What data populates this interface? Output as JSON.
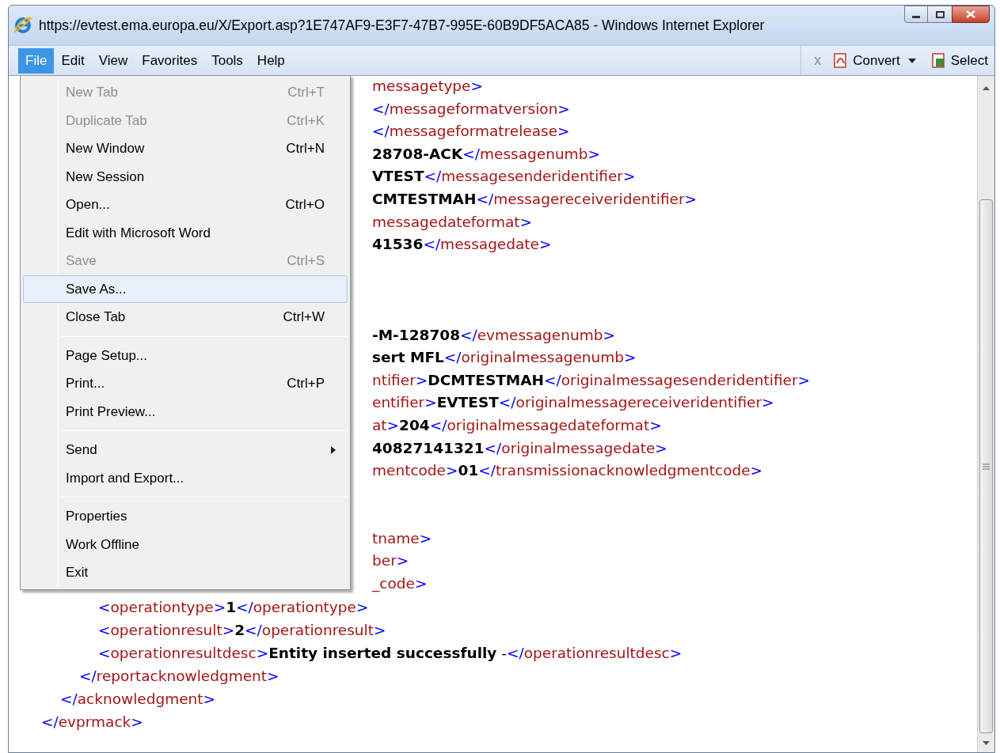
{
  "window": {
    "title": "https://evtest.ema.europa.eu/X/Export.asp?1E747AF9-E3F7-47B7-995E-60B9DF5ACA85 - Windows Internet Explorer"
  },
  "menu_bar": [
    {
      "label": "File",
      "selected": true
    },
    {
      "label": "Edit",
      "selected": false
    },
    {
      "label": "View",
      "selected": false
    },
    {
      "label": "Favorites",
      "selected": false
    },
    {
      "label": "Tools",
      "selected": false
    },
    {
      "label": "Help",
      "selected": false
    }
  ],
  "toolbar": {
    "close": "x",
    "convert": "Convert",
    "select": "Select"
  },
  "file_menu": {
    "groups": [
      [
        {
          "label": "New Tab",
          "shortcut": "Ctrl+T",
          "disabled": true,
          "selected": false
        },
        {
          "label": "Duplicate Tab",
          "shortcut": "Ctrl+K",
          "disabled": true,
          "selected": false
        },
        {
          "label": "New Window",
          "shortcut": "Ctrl+N",
          "disabled": false,
          "selected": false
        },
        {
          "label": "New Session",
          "disabled": false,
          "selected": false
        },
        {
          "label": "Open...",
          "shortcut": "Ctrl+O",
          "disabled": false,
          "selected": false
        },
        {
          "label": "Edit with Microsoft Word",
          "disabled": false,
          "selected": false
        },
        {
          "label": "Save",
          "shortcut": "Ctrl+S",
          "disabled": true,
          "selected": false
        },
        {
          "label": "Save As...",
          "disabled": false,
          "selected": true
        },
        {
          "label": "Close Tab",
          "shortcut": "Ctrl+W",
          "disabled": false,
          "selected": false
        }
      ],
      [
        {
          "label": "Page Setup...",
          "disabled": false,
          "selected": false
        },
        {
          "label": "Print...",
          "shortcut": "Ctrl+P",
          "disabled": false,
          "selected": false
        },
        {
          "label": "Print Preview...",
          "disabled": false,
          "selected": false
        }
      ],
      [
        {
          "label": "Send",
          "disabled": false,
          "selected": false,
          "submenu": true
        },
        {
          "label": "Import and Export...",
          "disabled": false,
          "selected": false
        }
      ],
      [
        {
          "label": "Properties",
          "disabled": false,
          "selected": false
        },
        {
          "label": "Work Offline",
          "disabled": false,
          "selected": false
        },
        {
          "label": "Exit",
          "disabled": false,
          "selected": false
        }
      ]
    ]
  },
  "document": {
    "lines": [
      {
        "kind": "partial",
        "parts": [
          {
            "kind": "tag",
            "text": "messagetype"
          },
          {
            "kind": "punct",
            "text": ">"
          }
        ]
      },
      {
        "kind": "partial",
        "parts": [
          {
            "kind": "punct",
            "text": "</"
          },
          {
            "kind": "tag",
            "text": "messageformatversion"
          },
          {
            "kind": "punct",
            "text": ">"
          }
        ]
      },
      {
        "kind": "partial",
        "parts": [
          {
            "kind": "punct",
            "text": "</"
          },
          {
            "kind": "tag",
            "text": "messageformatrelease"
          },
          {
            "kind": "punct",
            "text": ">"
          }
        ]
      },
      {
        "kind": "partial",
        "parts": [
          {
            "kind": "value",
            "text": "28708-ACK"
          },
          {
            "kind": "punct",
            "text": "</"
          },
          {
            "kind": "tag",
            "text": "messagenumb"
          },
          {
            "kind": "punct",
            "text": ">"
          }
        ]
      },
      {
        "kind": "partial",
        "parts": [
          {
            "kind": "value",
            "text": "VTEST"
          },
          {
            "kind": "punct",
            "text": "</"
          },
          {
            "kind": "tag",
            "text": "messagesenderidentifier"
          },
          {
            "kind": "punct",
            "text": ">"
          }
        ]
      },
      {
        "kind": "partial",
        "parts": [
          {
            "kind": "value",
            "text": "CMTESTMAH"
          },
          {
            "kind": "punct",
            "text": "</"
          },
          {
            "kind": "tag",
            "text": "messagereceiveridentifier"
          },
          {
            "kind": "punct",
            "text": ">"
          }
        ]
      },
      {
        "kind": "partial",
        "parts": [
          {
            "kind": "tag",
            "text": "messagedateformat"
          },
          {
            "kind": "punct",
            "text": ">"
          }
        ]
      },
      {
        "kind": "partial",
        "parts": [
          {
            "kind": "value",
            "text": "41536"
          },
          {
            "kind": "punct",
            "text": "</"
          },
          {
            "kind": "tag",
            "text": "messagedate"
          },
          {
            "kind": "punct",
            "text": ">"
          }
        ]
      },
      {
        "kind": "blank"
      },
      {
        "kind": "blank"
      },
      {
        "kind": "blank"
      },
      {
        "kind": "partial",
        "parts": [
          {
            "kind": "value",
            "text": "-M-128708"
          },
          {
            "kind": "punct",
            "text": "</"
          },
          {
            "kind": "tag",
            "text": "evmessagenumb"
          },
          {
            "kind": "punct",
            "text": ">"
          }
        ]
      },
      {
        "kind": "partial",
        "parts": [
          {
            "kind": "value",
            "text": "sert MFL"
          },
          {
            "kind": "punct",
            "text": "</"
          },
          {
            "kind": "tag",
            "text": "originalmessagenumb"
          },
          {
            "kind": "punct",
            "text": ">"
          }
        ]
      },
      {
        "kind": "partial",
        "parts": [
          {
            "kind": "tag",
            "text": "ntifier"
          },
          {
            "kind": "punct",
            "text": ">"
          },
          {
            "kind": "value",
            "text": "DCMTESTMAH"
          },
          {
            "kind": "punct",
            "text": "</"
          },
          {
            "kind": "tag",
            "text": "originalmessagesenderidentifier"
          },
          {
            "kind": "punct",
            "text": ">"
          }
        ]
      },
      {
        "kind": "partial",
        "parts": [
          {
            "kind": "tag",
            "text": "entifier"
          },
          {
            "kind": "punct",
            "text": ">"
          },
          {
            "kind": "value",
            "text": "EVTEST"
          },
          {
            "kind": "punct",
            "text": "</"
          },
          {
            "kind": "tag",
            "text": "originalmessagereceiveridentifier"
          },
          {
            "kind": "punct",
            "text": ">"
          }
        ]
      },
      {
        "kind": "partial",
        "parts": [
          {
            "kind": "tag",
            "text": "at"
          },
          {
            "kind": "punct",
            "text": ">"
          },
          {
            "kind": "value",
            "text": "204"
          },
          {
            "kind": "punct",
            "text": "</"
          },
          {
            "kind": "tag",
            "text": "originalmessagedateformat"
          },
          {
            "kind": "punct",
            "text": ">"
          }
        ]
      },
      {
        "kind": "partial",
        "parts": [
          {
            "kind": "value",
            "text": "40827141321"
          },
          {
            "kind": "punct",
            "text": "</"
          },
          {
            "kind": "tag",
            "text": "originalmessagedate"
          },
          {
            "kind": "punct",
            "text": ">"
          }
        ]
      },
      {
        "kind": "partial",
        "parts": [
          {
            "kind": "tag",
            "text": "mentcode"
          },
          {
            "kind": "punct",
            "text": ">"
          },
          {
            "kind": "value",
            "text": "01"
          },
          {
            "kind": "punct",
            "text": "</"
          },
          {
            "kind": "tag",
            "text": "transmissionacknowledgmentcode"
          },
          {
            "kind": "punct",
            "text": ">"
          }
        ]
      },
      {
        "kind": "blank"
      },
      {
        "kind": "blank"
      },
      {
        "kind": "partial",
        "parts": [
          {
            "kind": "tag",
            "text": "tname"
          },
          {
            "kind": "punct",
            "text": ">"
          }
        ]
      },
      {
        "kind": "partial",
        "parts": [
          {
            "kind": "tag",
            "text": "ber"
          },
          {
            "kind": "punct",
            "text": ">"
          }
        ]
      },
      {
        "kind": "partial",
        "parts": [
          {
            "kind": "tag",
            "text": "_code"
          },
          {
            "kind": "punct",
            "text": ">"
          }
        ]
      }
    ],
    "tree": {
      "close": [
        {
          "kind": "punct",
          "text": "</"
        },
        {
          "kind": "tag",
          "text": "evprmack"
        },
        {
          "kind": "punct",
          "text": ">"
        }
      ],
      "children": [
        {
          "close": [
            {
              "kind": "punct",
              "text": "</"
            },
            {
              "kind": "tag",
              "text": "acknowledgment"
            },
            {
              "kind": "punct",
              "text": ">"
            }
          ],
          "children": [
            {
              "close": [
                {
                  "kind": "punct",
                  "text": "</"
                },
                {
                  "kind": "tag",
                  "text": "reportacknowledgment"
                },
                {
                  "kind": "punct",
                  "text": ">"
                }
              ],
              "children": [
                {
                  "parts": [
                    {
                      "kind": "punct",
                      "text": "<"
                    },
                    {
                      "kind": "tag",
                      "text": "operationtype"
                    },
                    {
                      "kind": "punct",
                      "text": ">"
                    },
                    {
                      "kind": "value",
                      "text": "1"
                    },
                    {
                      "kind": "punct",
                      "text": "</"
                    },
                    {
                      "kind": "tag",
                      "text": "operationtype"
                    },
                    {
                      "kind": "punct",
                      "text": ">"
                    }
                  ]
                },
                {
                  "parts": [
                    {
                      "kind": "punct",
                      "text": "<"
                    },
                    {
                      "kind": "tag",
                      "text": "operationresult"
                    },
                    {
                      "kind": "punct",
                      "text": ">"
                    },
                    {
                      "kind": "value",
                      "text": "2"
                    },
                    {
                      "kind": "punct",
                      "text": "</"
                    },
                    {
                      "kind": "tag",
                      "text": "operationresult"
                    },
                    {
                      "kind": "punct",
                      "text": ">"
                    }
                  ]
                },
                {
                  "parts": [
                    {
                      "kind": "punct",
                      "text": "<"
                    },
                    {
                      "kind": "tag",
                      "text": "operationresultdesc"
                    },
                    {
                      "kind": "punct",
                      "text": ">"
                    },
                    {
                      "kind": "value",
                      "text": "Entity inserted successfully"
                    },
                    {
                      "kind": "text",
                      "text": " -"
                    },
                    {
                      "kind": "punct",
                      "text": "</"
                    },
                    {
                      "kind": "tag",
                      "text": "operationresultdesc"
                    },
                    {
                      "kind": "punct",
                      "text": ">"
                    }
                  ]
                }
              ]
            }
          ]
        }
      ]
    }
  }
}
